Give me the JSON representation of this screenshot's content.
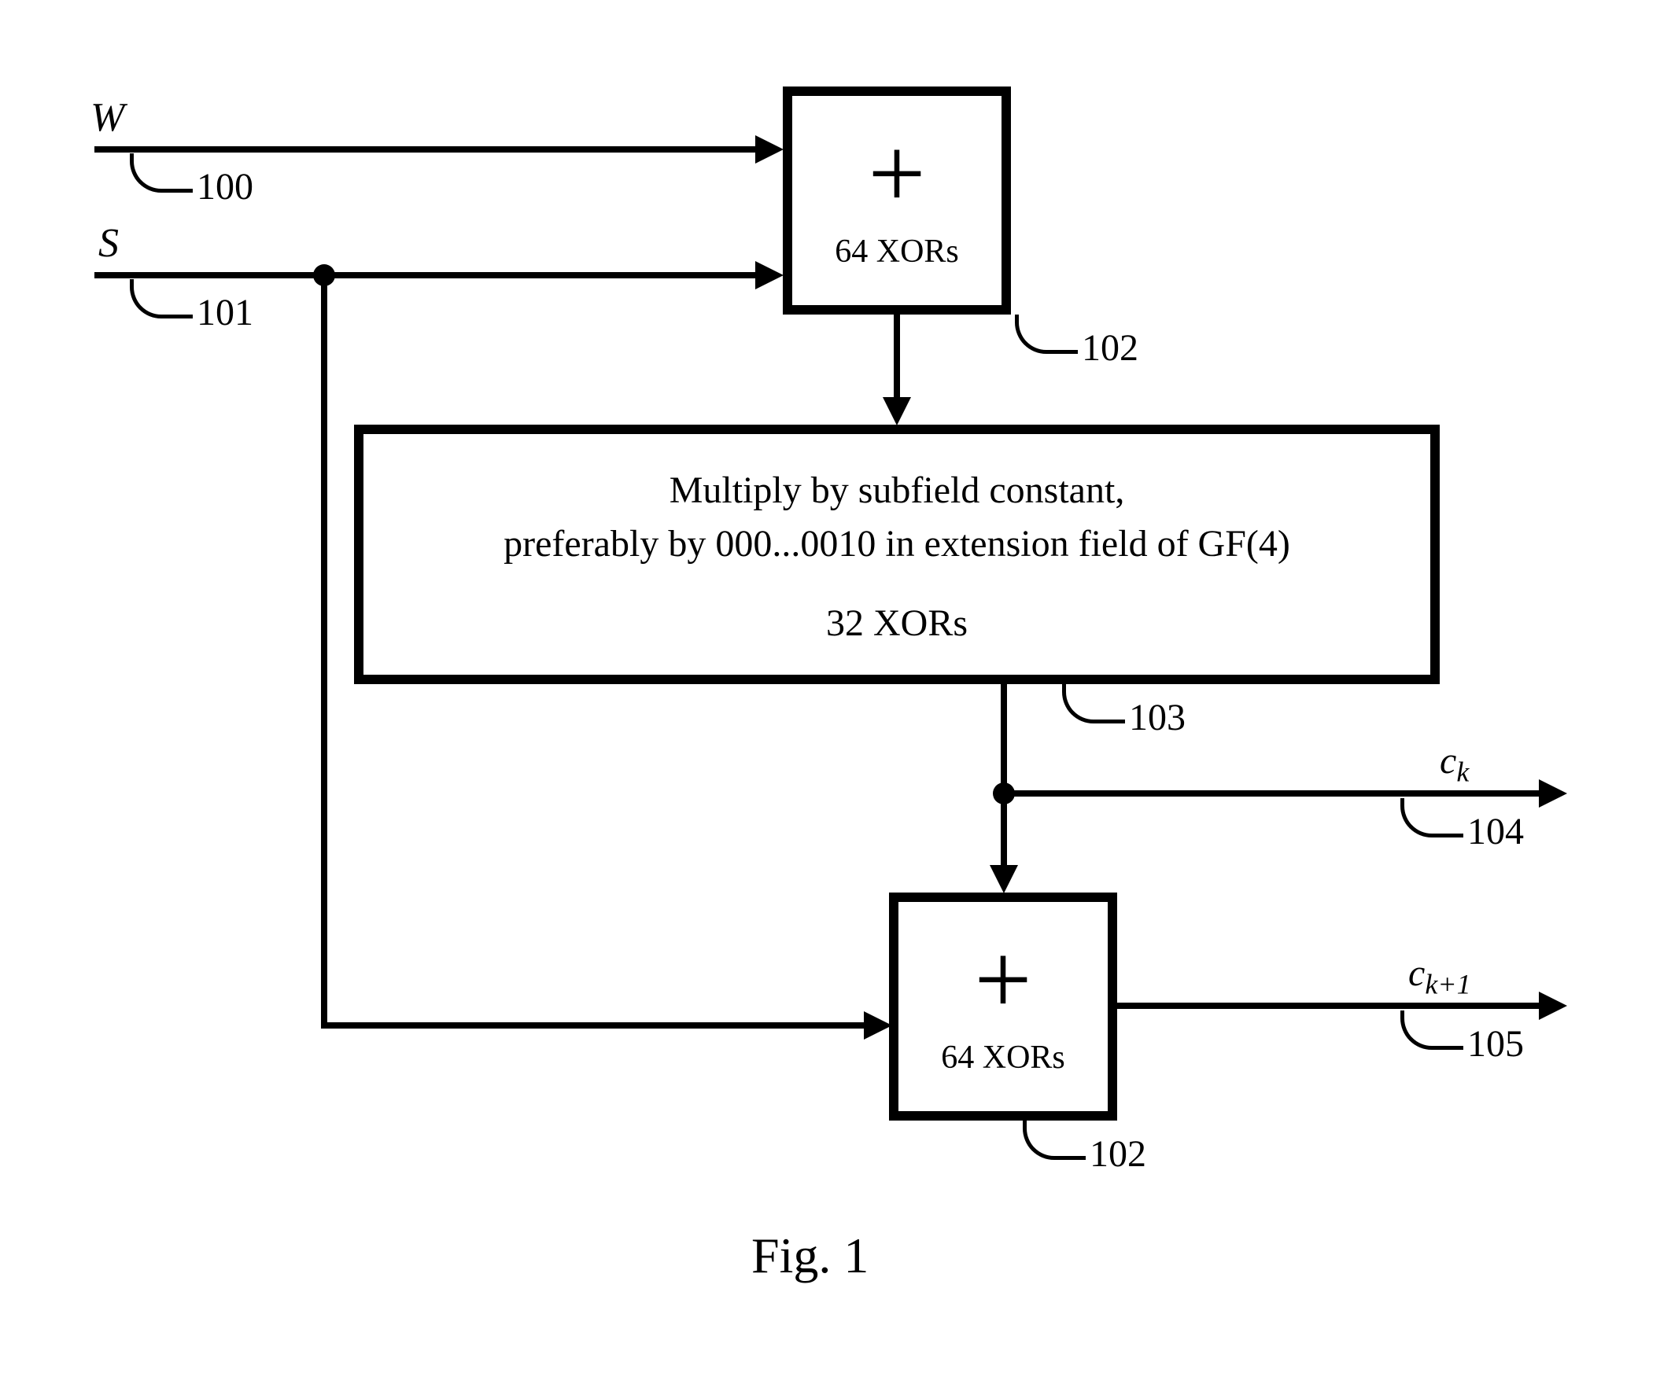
{
  "inputs": {
    "W": {
      "label": "W",
      "ref": "100"
    },
    "S": {
      "label": "S",
      "ref": "101"
    }
  },
  "blocks": {
    "adder1": {
      "symbol": "+",
      "text": "64 XORs",
      "ref": "102"
    },
    "multiplier": {
      "line1": "Multiply by subfield constant,",
      "line2": "preferably by 000...0010 in extension field of GF(4)",
      "xor_text": "32 XORs",
      "ref": "103"
    },
    "adder2": {
      "symbol": "+",
      "text": "64 XORs",
      "ref": "102"
    }
  },
  "outputs": {
    "ck": {
      "label_var": "c",
      "label_sub": "k",
      "ref": "104"
    },
    "ck1": {
      "label_var": "c",
      "label_sub": "k+1",
      "ref": "105"
    }
  },
  "figure_label": "Fig. 1"
}
